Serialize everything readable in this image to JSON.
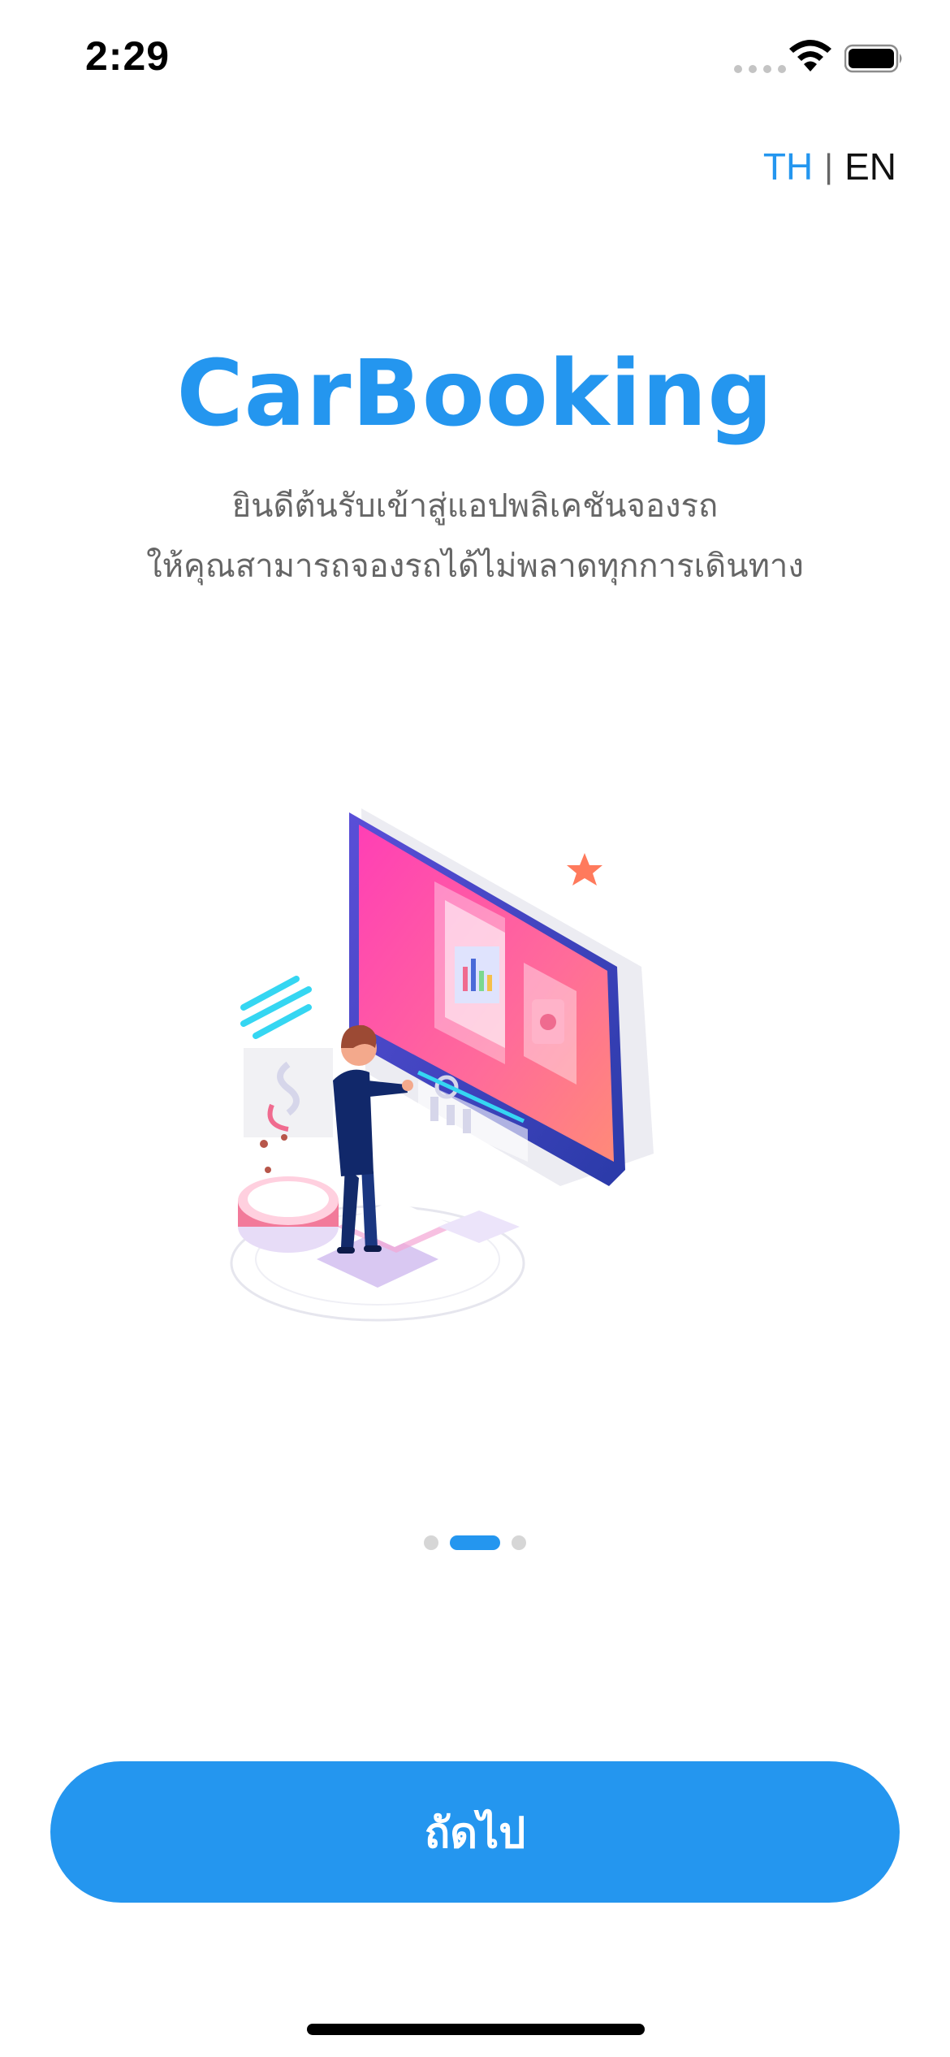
{
  "status_bar": {
    "time": "2:29",
    "wifi_icon": "wifi-icon",
    "battery_icon": "battery-icon"
  },
  "language": {
    "th_label": "TH",
    "separator": "|",
    "en_label": "EN",
    "active": "TH",
    "active_color": "#2496ef"
  },
  "onboarding": {
    "title": "CarBooking",
    "subtitle_line1": "ยินดีต้นรับเข้าสู่แอปพลิเคชันจองรถ",
    "subtitle_line2": "ให้คุณสามารถจองรถได้ไม่พลาดทุกการเดินทาง",
    "illustration_icon": "person-presenting-screen-illustration",
    "page_count": 3,
    "current_page": 2
  },
  "actions": {
    "next_label": "ถัดไป"
  },
  "colors": {
    "primary": "#2496ef",
    "subtitle": "#666666",
    "dot_inactive": "#d6d6d6"
  }
}
